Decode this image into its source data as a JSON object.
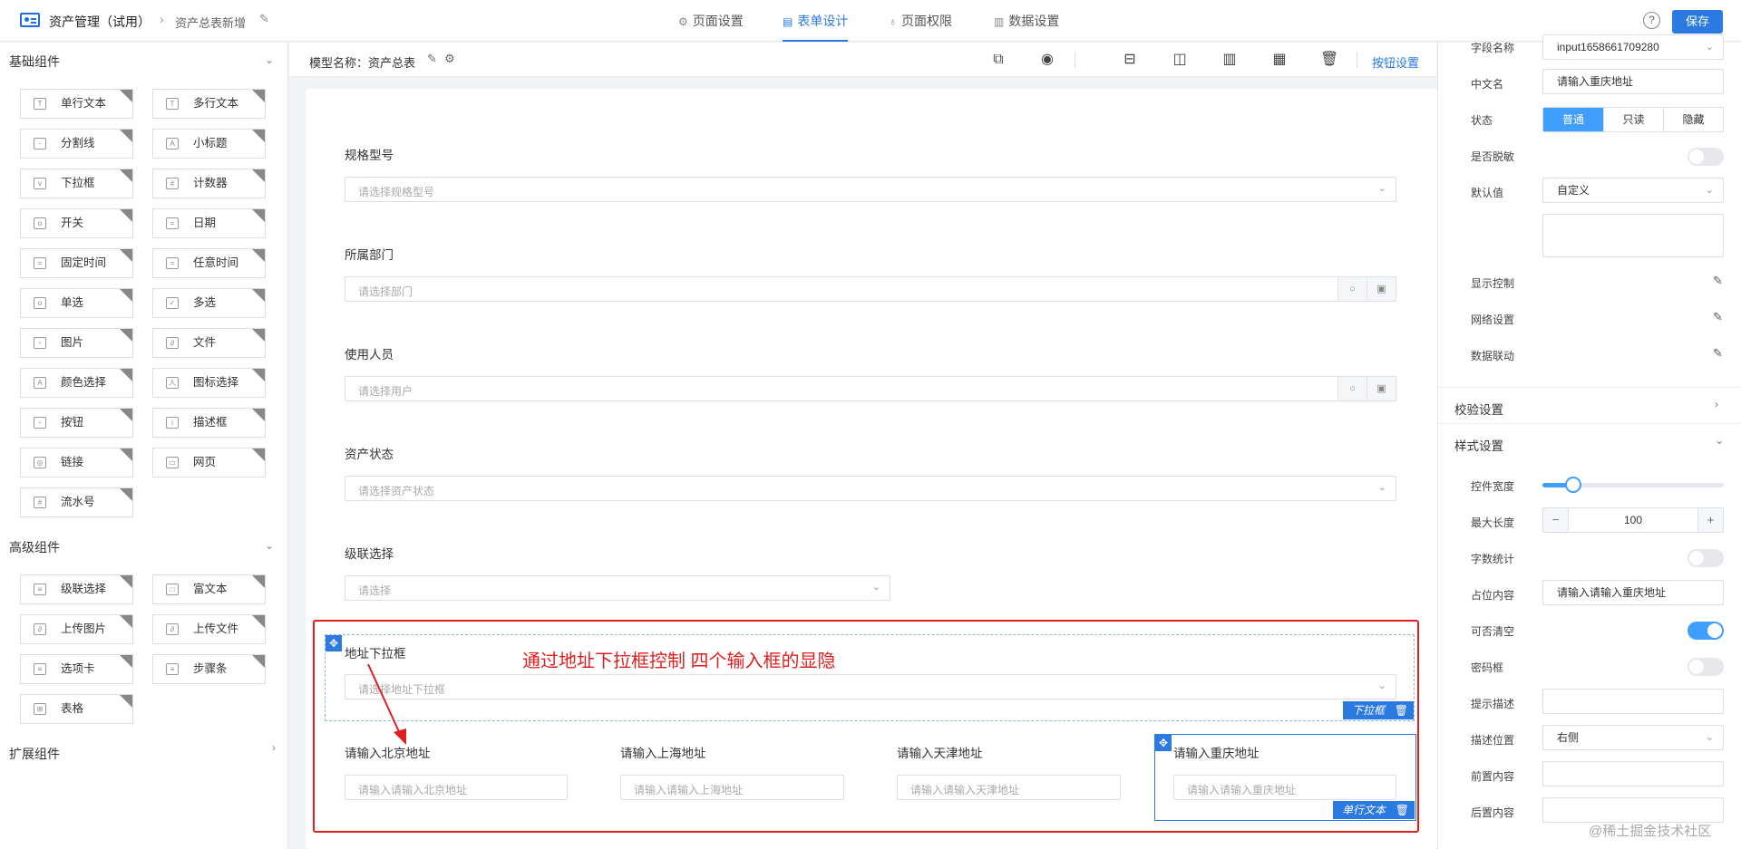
{
  "header": {
    "app_title": "资产管理（试用）",
    "breadcrumb_sep": "›",
    "breadcrumb": "资产总表新增",
    "tabs": [
      {
        "label": "页面设置",
        "icon": "gear-icon"
      },
      {
        "label": "表单设计",
        "icon": "document-icon"
      },
      {
        "label": "页面权限",
        "icon": "thermometer-icon"
      },
      {
        "label": "数据设置",
        "icon": "bar-chart-icon"
      }
    ],
    "active_tab": "表单设计",
    "help": "?",
    "save_label": "保存"
  },
  "left": {
    "basic_title": "基础组件",
    "basic": [
      {
        "label": "单行文本",
        "glyph": "T"
      },
      {
        "label": "多行文本",
        "glyph": "T"
      },
      {
        "label": "分割线",
        "glyph": "-"
      },
      {
        "label": "小标题",
        "glyph": "A"
      },
      {
        "label": "下拉框",
        "glyph": "v"
      },
      {
        "label": "计数器",
        "glyph": "#"
      },
      {
        "label": "开关",
        "glyph": "o"
      },
      {
        "label": "日期",
        "glyph": "="
      },
      {
        "label": "固定时间",
        "glyph": "="
      },
      {
        "label": "任意时间",
        "glyph": "="
      },
      {
        "label": "单选",
        "glyph": "o"
      },
      {
        "label": "多选",
        "glyph": "✓"
      },
      {
        "label": "图片",
        "glyph": "▫"
      },
      {
        "label": "文件",
        "glyph": "∂"
      },
      {
        "label": "颜色选择",
        "glyph": "A"
      },
      {
        "label": "图标选择",
        "glyph": "人"
      },
      {
        "label": "按钮",
        "glyph": "▫"
      },
      {
        "label": "描述框",
        "glyph": "i"
      },
      {
        "label": "链接",
        "glyph": "◎"
      },
      {
        "label": "网页",
        "glyph": "▭"
      },
      {
        "label": "流水号",
        "glyph": "#"
      }
    ],
    "advanced_title": "高级组件",
    "advanced": [
      {
        "label": "级联选择",
        "glyph": "≡"
      },
      {
        "label": "富文本",
        "glyph": "□"
      },
      {
        "label": "上传图片",
        "glyph": "∂"
      },
      {
        "label": "上传文件",
        "glyph": "∂"
      },
      {
        "label": "选项卡",
        "glyph": "≡"
      },
      {
        "label": "步骤条",
        "glyph": "≡"
      },
      {
        "label": "表格",
        "glyph": "⊞"
      }
    ],
    "extension_title": "扩展组件"
  },
  "toolbar": {
    "model_label": "模型名称：资产总表",
    "button_settings": "按钮设置"
  },
  "form": {
    "fields": [
      {
        "label": "规格型号",
        "placeholder": "请选择规格型号",
        "kind": "select"
      },
      {
        "label": "所属部门",
        "placeholder": "请选择部门",
        "kind": "picker"
      },
      {
        "label": "使用人员",
        "placeholder": "请选择用户",
        "kind": "picker"
      },
      {
        "label": "资产状态",
        "placeholder": "请选择资产状态",
        "kind": "select"
      },
      {
        "label": "级联选择",
        "placeholder": "请选择",
        "kind": "select"
      }
    ],
    "address_select": {
      "label": "地址下拉框",
      "placeholder": "请选择地址下拉框",
      "tag": "下拉框"
    },
    "address_inputs": [
      {
        "label": "请输入北京地址",
        "placeholder": "请输入请输入北京地址"
      },
      {
        "label": "请输入上海地址",
        "placeholder": "请输入请输入上海地址"
      },
      {
        "label": "请输入天津地址",
        "placeholder": "请输入请输入天津地址"
      },
      {
        "label": "请输入重庆地址",
        "placeholder": "请输入请输入重庆地址"
      }
    ],
    "selected_tag": "单行文本",
    "annotation": "通过地址下拉框控制    四个输入框的显隐"
  },
  "props": {
    "field_name_label": "字段名称",
    "field_name_value": "input1658661709280",
    "cn_name_label": "中文名",
    "cn_name_value": "请输入重庆地址",
    "status_label": "状态",
    "status_options": [
      "普通",
      "只读",
      "隐藏"
    ],
    "status_selected": "普通",
    "desensitize_label": "是否脱敏",
    "desensitize": false,
    "default_label": "默认值",
    "default_value": "自定义",
    "display_control_label": "显示控制",
    "grid_label": "网络设置",
    "linkage_label": "数据联动",
    "validation_title": "校验设置",
    "style_title": "样式设置",
    "width_label": "控件宽度",
    "width_fraction": 0.17,
    "maxlen_label": "最大长度",
    "maxlen_value": "100",
    "minus": "−",
    "plus": "+",
    "wordcount_label": "字数统计",
    "wordcount": false,
    "placeholder_label": "占位内容",
    "placeholder_value": "请输入请输入重庆地址",
    "clearable_label": "可否清空",
    "clearable": true,
    "password_label": "密码框",
    "password": false,
    "hint_label": "提示描述",
    "hint_value": "",
    "desc_pos_label": "描述位置",
    "desc_pos_value": "右侧",
    "prefix_label": "前置内容",
    "prefix_value": "",
    "suffix_label": "后置内容",
    "suffix_value": ""
  },
  "watermark": "@稀土掘金技术社区",
  "colors": {
    "accent": "#2a7ae2",
    "annotation": "#e02020"
  }
}
